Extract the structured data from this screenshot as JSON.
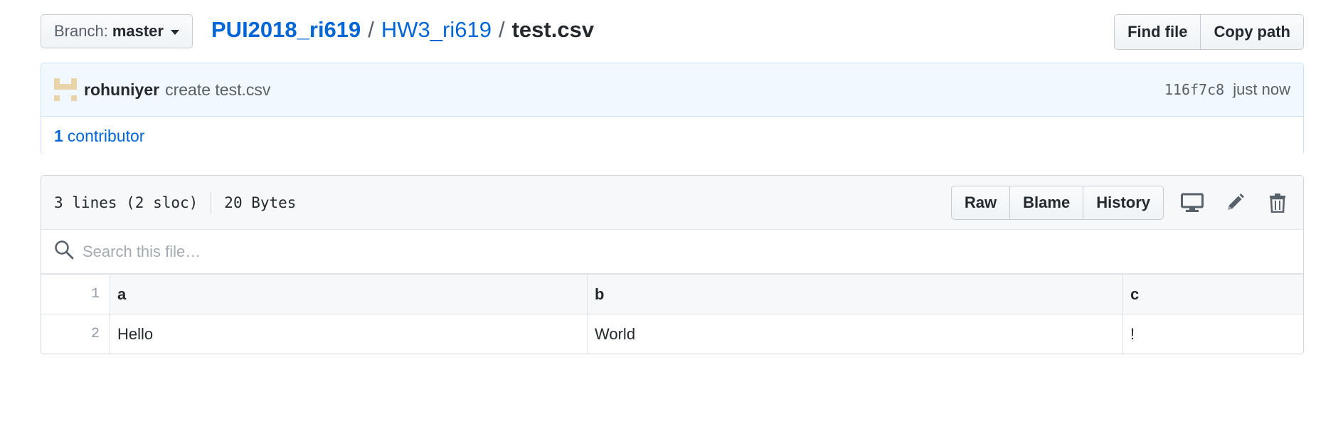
{
  "file_nav": {
    "branch_prefix": "Branch:",
    "branch_name": "master",
    "breadcrumb": {
      "repo": "PUI2018_ri619",
      "sep1": "/",
      "dir": "HW3_ri619",
      "sep2": "/",
      "file": "test.csv"
    },
    "find_file_label": "Find file",
    "copy_path_label": "Copy path"
  },
  "commit": {
    "author": "rohuniyer",
    "message": "create test.csv",
    "sha": "116f7c8",
    "time": "just now"
  },
  "contributors": {
    "count": "1",
    "label": "contributor"
  },
  "file": {
    "lines_info": "3 lines (2 sloc)",
    "size": "20 Bytes",
    "actions": {
      "raw": "Raw",
      "blame": "Blame",
      "history": "History"
    },
    "icons": [
      "desktop-icon",
      "pencil-icon",
      "trash-icon"
    ],
    "search_placeholder": "Search this file…",
    "table": {
      "header": {
        "line": "1",
        "cells": [
          "a",
          "b",
          "c"
        ]
      },
      "rows": [
        {
          "line": "2",
          "cells": [
            "Hello",
            "World",
            "!"
          ]
        }
      ]
    }
  },
  "colors": {
    "link": "#0366d6",
    "commit_bg": "#f1f8ff",
    "header_bg": "#f6f8fa"
  }
}
